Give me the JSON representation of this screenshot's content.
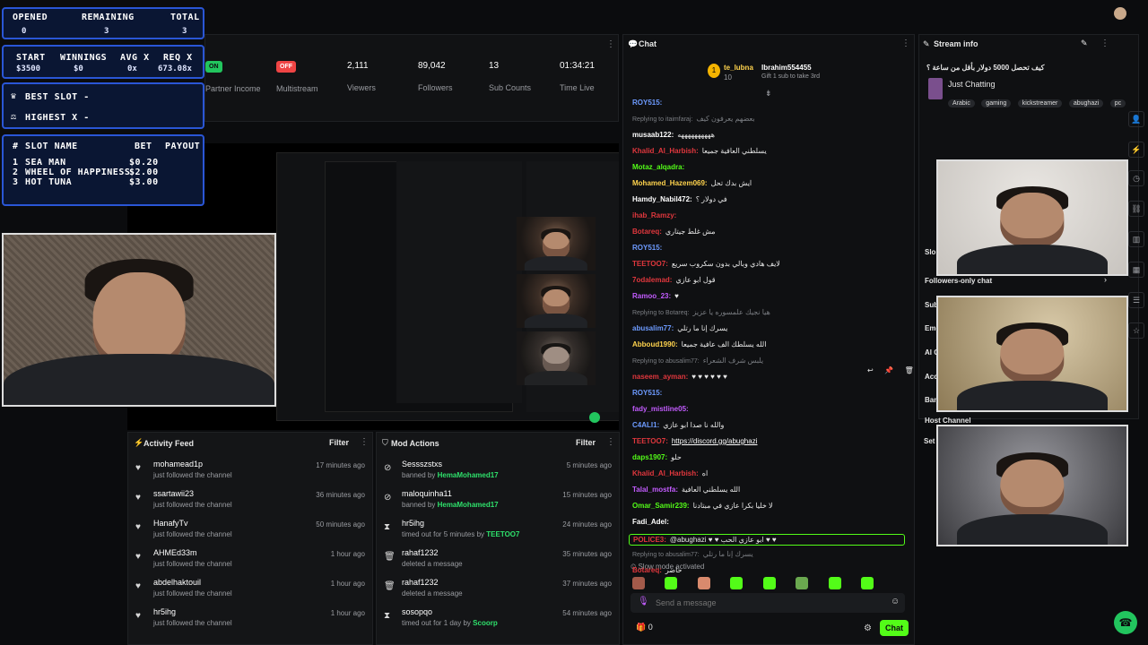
{
  "overlay": {
    "opened_h": "OPENED",
    "remaining_h": "REMAINING",
    "total_h": "TOTAL",
    "opened": "0",
    "remaining": "3",
    "total": "3",
    "start_h": "START",
    "winnings_h": "WINNINGS",
    "avgx_h": "AVG X",
    "reqx_h": "REQ X",
    "start": "$3500",
    "winnings": "$0",
    "avgx": "0x",
    "reqx": "673.08x",
    "best_slot": "BEST SLOT -",
    "highest_x": "HIGHEST X -",
    "table_headers": [
      "#",
      "SLOT NAME",
      "BET",
      "PAYOUT"
    ],
    "slots": [
      {
        "n": "1",
        "name": "SEA MAN",
        "bet": "$0.20"
      },
      {
        "n": "2",
        "name": "WHEEL OF HAPPINESS",
        "bet": "$2.00"
      },
      {
        "n": "3",
        "name": "HOT TUNA",
        "bet": "$3.00"
      }
    ]
  },
  "stats": {
    "on": "ON",
    "partner_income": "Partner Income",
    "off": "OFF",
    "multistream": "Multistream",
    "viewers": "2,111",
    "viewers_l": "Viewers",
    "followers": "89,042",
    "followers_l": "Followers",
    "subs": "13",
    "subs_l": "Sub Counts",
    "time": "01:34:21",
    "time_l": "Time Live"
  },
  "activity": {
    "title": "Activity Feed",
    "filter": "Filter",
    "rows": [
      {
        "name": "mohamead1p",
        "sub": "just followed the channel",
        "time": "17 minutes ago"
      },
      {
        "name": "ssartawii23",
        "sub": "just followed the channel",
        "time": "36 minutes ago"
      },
      {
        "name": "HanafyTv",
        "sub": "just followed the channel",
        "time": "50 minutes ago"
      },
      {
        "name": "AHMEd33m",
        "sub": "just followed the channel",
        "time": "1 hour ago"
      },
      {
        "name": "abdelhaktouil",
        "sub": "just followed the channel",
        "time": "1 hour ago"
      },
      {
        "name": "hr5ihg",
        "sub": "just followed the channel",
        "time": "1 hour ago"
      }
    ]
  },
  "mod": {
    "title": "Mod Actions",
    "filter": "Filter",
    "rows": [
      {
        "name": "Sessszstxs",
        "pre": "banned by ",
        "by": "HemaMohamed17",
        "time": "5 minutes ago"
      },
      {
        "name": "maloquinha11",
        "pre": "banned by ",
        "by": "HemaMohamed17",
        "time": "15 minutes ago"
      },
      {
        "name": "hr5ihg",
        "pre": "timed out for 5 minutes by ",
        "by": "TEETOO7",
        "time": "24 minutes ago"
      },
      {
        "name": "rahaf1232",
        "pre": "deleted a message",
        "by": "",
        "time": "35 minutes ago"
      },
      {
        "name": "rahaf1232",
        "pre": "deleted a message",
        "by": "",
        "time": "37 minutes ago"
      },
      {
        "name": "sosopqo",
        "pre": "timed out for 1 day by ",
        "by": "Scoorp",
        "time": "54 minutes ago"
      }
    ]
  },
  "chat": {
    "title": "Chat",
    "gifter1": "te_lubna",
    "gifter1_count": "10",
    "gifter2": "Ibrahim554455",
    "gift_text": "Gift 1 sub to take 3rd",
    "messages": [
      {
        "u": "ROY515:",
        "c": "#6d9bff",
        "t": ""
      },
      {
        "u": "Replying to itaimfaraj:",
        "c": "#7a7d82",
        "t": "بعضهم يعرفون كيف",
        "reply": true
      },
      {
        "u": "musaab122:",
        "c": "#ffffff",
        "t": "ههههههههههه"
      },
      {
        "u": "Khalid_Al_Harbish:",
        "c": "#e0373d",
        "t": "يسلطني العافية جميعا"
      },
      {
        "u": "Motaz_alqadra:",
        "c": "#53fc18",
        "t": ""
      },
      {
        "u": "Mohamed_Hazem069:",
        "c": "#ffd34d",
        "t": "ايش بدك تحل"
      },
      {
        "u": "Hamdy_Nabil472:",
        "c": "#ffffff",
        "t": "في دولار ؟"
      },
      {
        "u": "ihab_Ramzy:",
        "c": "#e0373d",
        "t": ""
      },
      {
        "u": "Botareq:",
        "c": "#e0373d",
        "t": "مش غلط جيتاري"
      },
      {
        "u": "ROY515:",
        "c": "#6d9bff",
        "t": ""
      },
      {
        "u": "TEETOO7:",
        "c": "#e0373d",
        "t": "لايف هادي وبالي بدون سكروب سريع"
      },
      {
        "u": "7odalemad:",
        "c": "#e0373d",
        "t": "قول ابو عازي"
      },
      {
        "u": "Ramoo_23:",
        "c": "#c35cff",
        "t": "♥"
      },
      {
        "u": "Replying to Botareq:",
        "c": "#7a7d82",
        "t": "هيا نجيك علمسوره يا عزيز",
        "reply": true
      },
      {
        "u": "abusalim77:",
        "c": "#6d9bff",
        "t": "يسرك إنا ما رتلي"
      },
      {
        "u": "Abboud1990:",
        "c": "#ffd34d",
        "t": "الله يسلطك الف عافية جميعا"
      },
      {
        "u": "Replying to abusalim77:",
        "c": "#7a7d82",
        "t": "يلبس شرف الشعراء",
        "reply": true
      },
      {
        "u": "naseem_ayman:",
        "c": "#e0373d",
        "t": "♥ ♥ ♥ ♥ ♥ ♥"
      },
      {
        "u": "ROY515:",
        "c": "#6d9bff",
        "t": ""
      },
      {
        "u": "fady_mistline05:",
        "c": "#c35cff",
        "t": ""
      },
      {
        "u": "C4ALI1:",
        "c": "#6d9bff",
        "t": "والله نا صدا ابو عازي"
      },
      {
        "u": "TEETOO7:",
        "c": "#e0373d",
        "t": "https://discord.gg/abughazi",
        "link": true
      },
      {
        "u": "daps1907:",
        "c": "#53fc18",
        "t": "حلو"
      },
      {
        "u": "Khalid_Al_Harbish:",
        "c": "#e0373d",
        "t": "اه"
      },
      {
        "u": "Talal_mostfa:",
        "c": "#c35cff",
        "t": "الله يسلطني العافية"
      },
      {
        "u": "Omar_Samir239:",
        "c": "#53fc18",
        "t": "لا خليا بكرا عازي في مبتادنا"
      },
      {
        "u": "Fadi_Adel:",
        "c": "#ffffff",
        "t": ""
      },
      {
        "u": "POLICE3:",
        "c": "#e0373d",
        "t": "@abughazi ♥ ♥ ابو عازي الحب ♥ ♥"
      },
      {
        "u": "Replying to abusalim77:",
        "c": "#7a7d82",
        "t": "يسرك إنا ما رتلي",
        "reply": true
      },
      {
        "u": "Botareq:",
        "c": "#e0373d",
        "t": "حاضر"
      }
    ],
    "slow_mode": "Slow mode activated",
    "placeholder": "Send a message",
    "count": "0",
    "send": "Chat"
  },
  "stream_info": {
    "title": "Stream info",
    "stream_title": "كيف تحصل 5000 دولار بأقل من ساعة ؟",
    "category": "Just Chatting",
    "tags": [
      "Arabic",
      "gaming",
      "kickstreamer",
      "abughazi",
      "pc"
    ]
  },
  "side_labels": {
    "followers_only": "Followers-only chat",
    "host_channel": "Host Channel",
    "slow": "Slo",
    "sub": "Sub",
    "eme": "Eme",
    "ai": "AI C",
    "acc": "Acc",
    "ban": "Ban",
    "set": "Set"
  },
  "colors": {
    "accent": "#53fc18",
    "overlay_border": "#2a56d6",
    "overlay_bg": "#0a1633"
  }
}
